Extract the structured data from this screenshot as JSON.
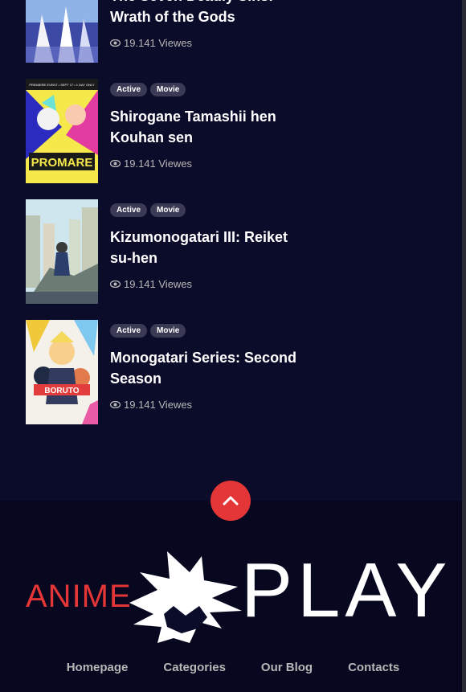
{
  "items": [
    {
      "title": "The Seven Deadly Sins: Wrath of the Gods",
      "tags": [],
      "views": "19.141 Viewes",
      "thumb_icon": "anime-poster-blue"
    },
    {
      "title": "Shirogane Tamashii hen Kouhan sen",
      "tags": [
        "Active",
        "Movie"
      ],
      "views": "19.141 Viewes",
      "thumb_icon": "anime-poster-promare",
      "thumb_text": "PROMARE",
      "thumb_caption": "PREMIERE EVENT • SEPT 17 • 1 DAY ONLY"
    },
    {
      "title": "Kizumonogatari III: Reiket su-hen",
      "tags": [
        "Active",
        "Movie"
      ],
      "views": "19.141 Viewes",
      "thumb_icon": "anime-poster-city"
    },
    {
      "title": "Monogatari Series: Second Season",
      "tags": [
        "Active",
        "Movie"
      ],
      "views": "19.141 Viewes",
      "thumb_icon": "anime-poster-boruto",
      "thumb_text": "BORUTO"
    }
  ],
  "logo": {
    "left": "ANIME",
    "right": "PLAY"
  },
  "footer_nav": [
    "Homepage",
    "Categories",
    "Our Blog",
    "Contacts"
  ],
  "colors": {
    "accent": "#e53637",
    "background": "#0b0c2a",
    "footer": "#070720",
    "tag": "#3a3a55"
  }
}
